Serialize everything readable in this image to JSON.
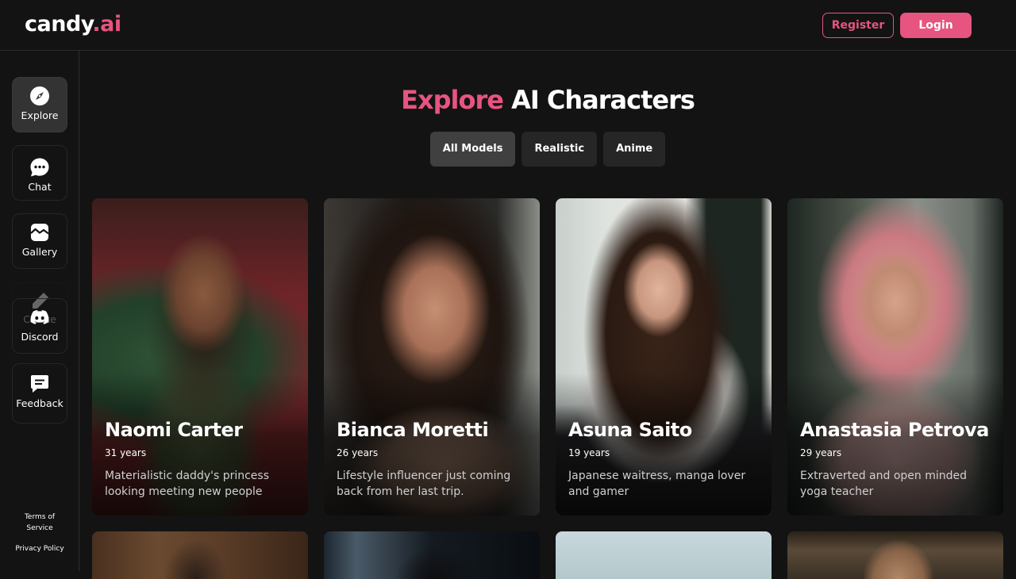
{
  "header": {
    "logo_main": "candy",
    "logo_accent": ".ai",
    "register_label": "Register",
    "login_label": "Login"
  },
  "colors": {
    "accent": "#e75480",
    "background": "#131313"
  },
  "sidebar": {
    "items": [
      {
        "label": "Explore",
        "icon": "compass-icon",
        "active": true
      },
      {
        "label": "Chat",
        "icon": "chat-bubble-icon",
        "active": false
      },
      {
        "label": "Gallery",
        "icon": "image-icon",
        "active": false
      },
      {
        "label": "Create",
        "icon": "pencil-plus-icon",
        "active": false
      },
      {
        "label": "Discord",
        "icon": "discord-icon",
        "active": false
      },
      {
        "label": "Feedback",
        "icon": "feedback-icon",
        "active": false
      }
    ],
    "terms_label": "Terms of Service",
    "privacy_label": "Privacy Policy"
  },
  "main": {
    "title_accent": "Explore",
    "title_rest": " AI Characters",
    "filters": [
      {
        "label": "All Models",
        "active": true
      },
      {
        "label": "Realistic",
        "active": false
      },
      {
        "label": "Anime",
        "active": false
      }
    ],
    "characters": [
      {
        "name": "Naomi Carter",
        "age": "31 years",
        "description": "Materialistic daddy's princess looking meeting new people"
      },
      {
        "name": "Bianca Moretti",
        "age": "26 years",
        "description": "Lifestyle influencer just coming back from her last trip."
      },
      {
        "name": "Asuna Saito",
        "age": "19 years",
        "description": "Japanese waitress, manga lover and gamer"
      },
      {
        "name": "Anastasia Petrova",
        "age": "29 years",
        "description": "Extraverted and open minded yoga teacher"
      }
    ]
  }
}
